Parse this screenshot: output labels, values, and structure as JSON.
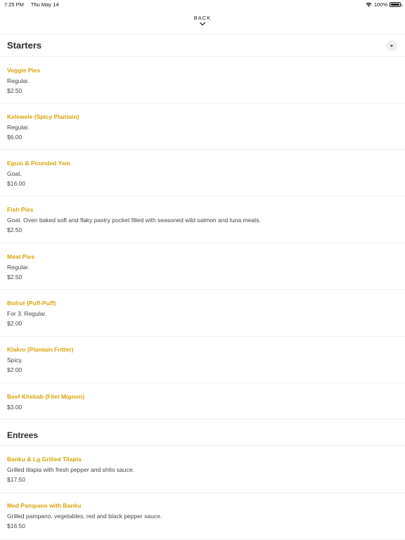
{
  "status_bar": {
    "time": "7:25 PM",
    "date": "Thu May 14",
    "battery": "100%"
  },
  "nav": {
    "back_label": "BACK"
  },
  "sections": [
    {
      "title": "Starters",
      "items": [
        {
          "name": "Veggie Pies",
          "description": "Regular.",
          "price": "$2.50"
        },
        {
          "name": "Kelewele (Spicy Plantain)",
          "description": "Regular.",
          "price": "$6.00"
        },
        {
          "name": "Egusi & Pounded Yam",
          "description": "Goat.",
          "price": "$16.00"
        },
        {
          "name": "Fish Pies",
          "description": "Goat. Oven baked soft and flaky pastry pocket filled with seasoned wild salmon and tuna meats.",
          "price": "$2.50"
        },
        {
          "name": "Meat Pies",
          "description": "Regular.",
          "price": "$2.50"
        },
        {
          "name": "Bofrot (Puff-Puff)",
          "description": "For 3. Regular.",
          "price": "$2.00"
        },
        {
          "name": "Klakro (Plantain Fritter)",
          "description": "Spicy.",
          "price": "$2.00"
        },
        {
          "name": "Beef Khebab (Filet Mignon)",
          "description": "",
          "price": "$3.00"
        }
      ]
    },
    {
      "title": "Entrees",
      "items": [
        {
          "name": "Banku & Lg Grilled Tilapia",
          "description": "Grilled tilapia with fresh pepper and shito sauce.",
          "price": "$17.50"
        },
        {
          "name": "Med Pampano with Banku",
          "description": "Grilled pampano, vegetables, red and black pepper sauce.",
          "price": "$16.50"
        }
      ]
    }
  ]
}
